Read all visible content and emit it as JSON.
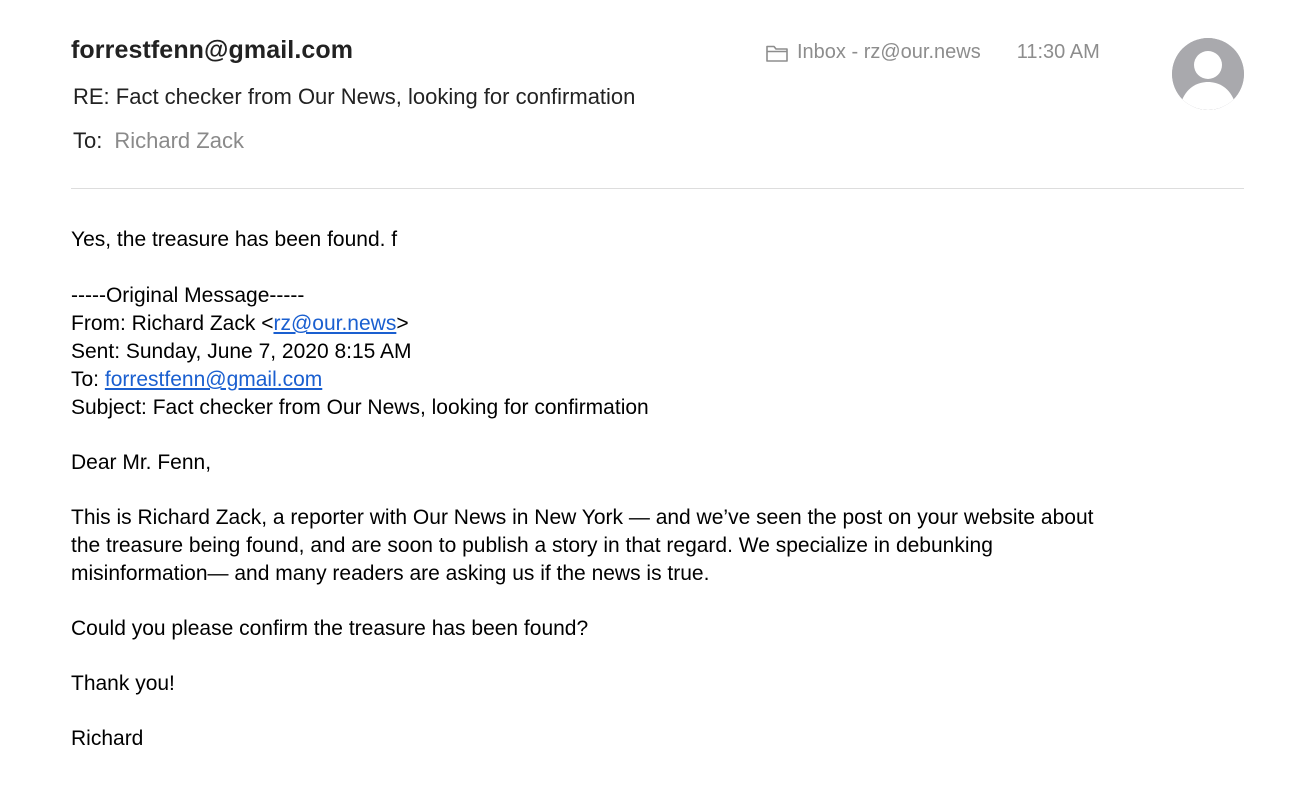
{
  "email": {
    "from": "forrestfenn@gmail.com",
    "subject": "RE: Fact checker from Our News, looking for confirmation",
    "to_label": "To:",
    "to_name": "Richard Zack",
    "mailbox": "Inbox - rz@our.news",
    "time": "11:30 AM",
    "folder_icon": "folder-icon",
    "avatar_icon": "person-silhouette-icon"
  },
  "body": {
    "reply": "Yes, the treasure has been found. f",
    "original_header": "-----Original Message-----",
    "from_prefix": "From: Richard Zack <",
    "from_email": "rz@our.news",
    "from_suffix": ">",
    "sent": "Sent: Sunday, June 7, 2020 8:15 AM",
    "to_prefix": "To: ",
    "to_email": "forrestfenn@gmail.com",
    "subject": "Subject: Fact checker from Our News, looking for confirmation",
    "greeting": "Dear Mr. Fenn,",
    "paragraph_line1": "This is Richard Zack, a reporter with Our News in New York — and we’ve seen the post on your website about",
    "paragraph_line2": "the treasure being found, and are soon to publish a story in that regard.  We specialize in debunking",
    "paragraph_line3": "misinformation— and many readers are asking us if the news is true.",
    "question": "Could you please confirm the treasure has been found?",
    "thanks": "Thank you!",
    "signature": "Richard"
  },
  "colors": {
    "link": "#1a5fd0",
    "muted": "#8d8d8d",
    "avatar": "#a9a9ad"
  }
}
